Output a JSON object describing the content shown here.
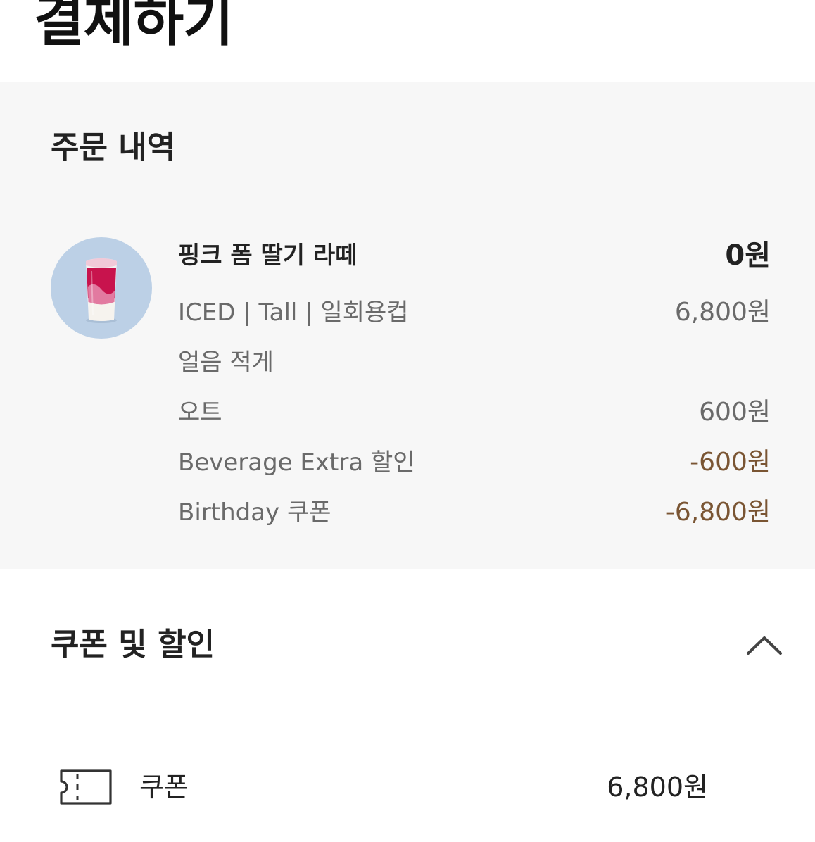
{
  "page": {
    "title": "결제하기"
  },
  "order": {
    "section_title": "주문 내역",
    "product": {
      "name": "핑크 폼 딸기 라떼",
      "price": "0원",
      "image": "pink-strawberry-latte-drink"
    },
    "details": [
      {
        "label": "ICED | Tall | 일회용컵",
        "value": "6,800원",
        "type": "normal"
      },
      {
        "label": "얼음 적게",
        "value": "",
        "type": "normal"
      },
      {
        "label": "오트",
        "value": "600원",
        "type": "normal"
      },
      {
        "label": "Beverage Extra 할인",
        "value": "-600원",
        "type": "discount"
      },
      {
        "label": "Birthday 쿠폰",
        "value": "-6,800원",
        "type": "discount"
      }
    ]
  },
  "coupon_discount": {
    "section_title": "쿠폰 및 할인",
    "toggle_icon": "chevron-up-icon",
    "coupon": {
      "icon": "ticket-icon",
      "label": "쿠폰",
      "value": "6,800원"
    }
  },
  "colors": {
    "section_bg": "#f7f7f7",
    "discount_text": "#7a5533",
    "muted_text": "#6a6a6a",
    "thumb_bg": "#bcd0e6"
  }
}
